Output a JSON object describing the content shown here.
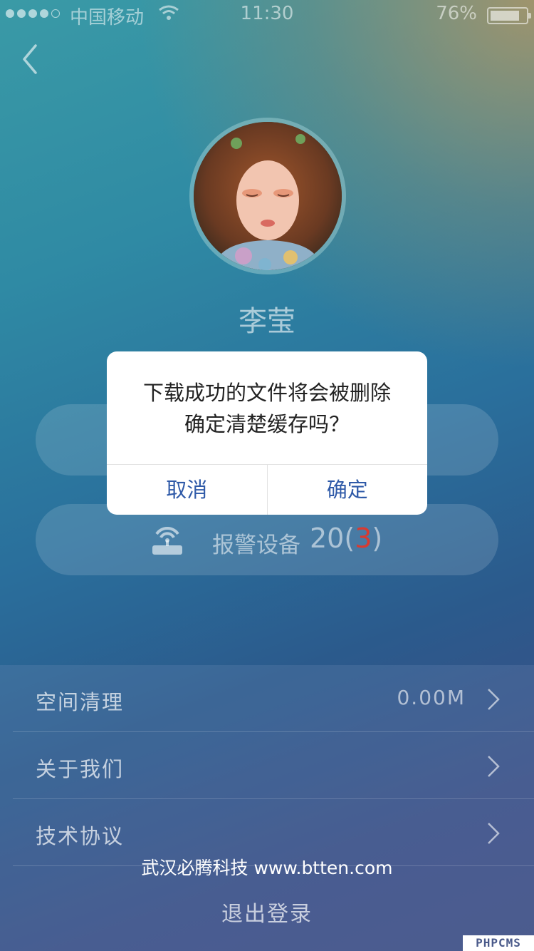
{
  "status_bar": {
    "carrier": "中国移动",
    "time": "11:30",
    "battery": "76%"
  },
  "profile": {
    "name": "李莹"
  },
  "alarm": {
    "label": "报警设备",
    "count_prefix": "20(",
    "count_alert": "3",
    "count_suffix": ")"
  },
  "settings": [
    {
      "label": "空间清理",
      "value": "0.00M"
    },
    {
      "label": "关于我们",
      "value": ""
    },
    {
      "label": "技术协议",
      "value": ""
    }
  ],
  "watermark": "武汉必腾科技 www.btten.com",
  "logout_label": "退出登录",
  "corner_badge": "PHPCMS",
  "dialog": {
    "line1": "下载成功的文件将会被删除",
    "line2": "确定清楚缓存吗？",
    "cancel": "取消",
    "confirm": "确定"
  },
  "colors": {
    "dialog_button": "#2f5aa8",
    "alert_count": "#d93a30"
  }
}
